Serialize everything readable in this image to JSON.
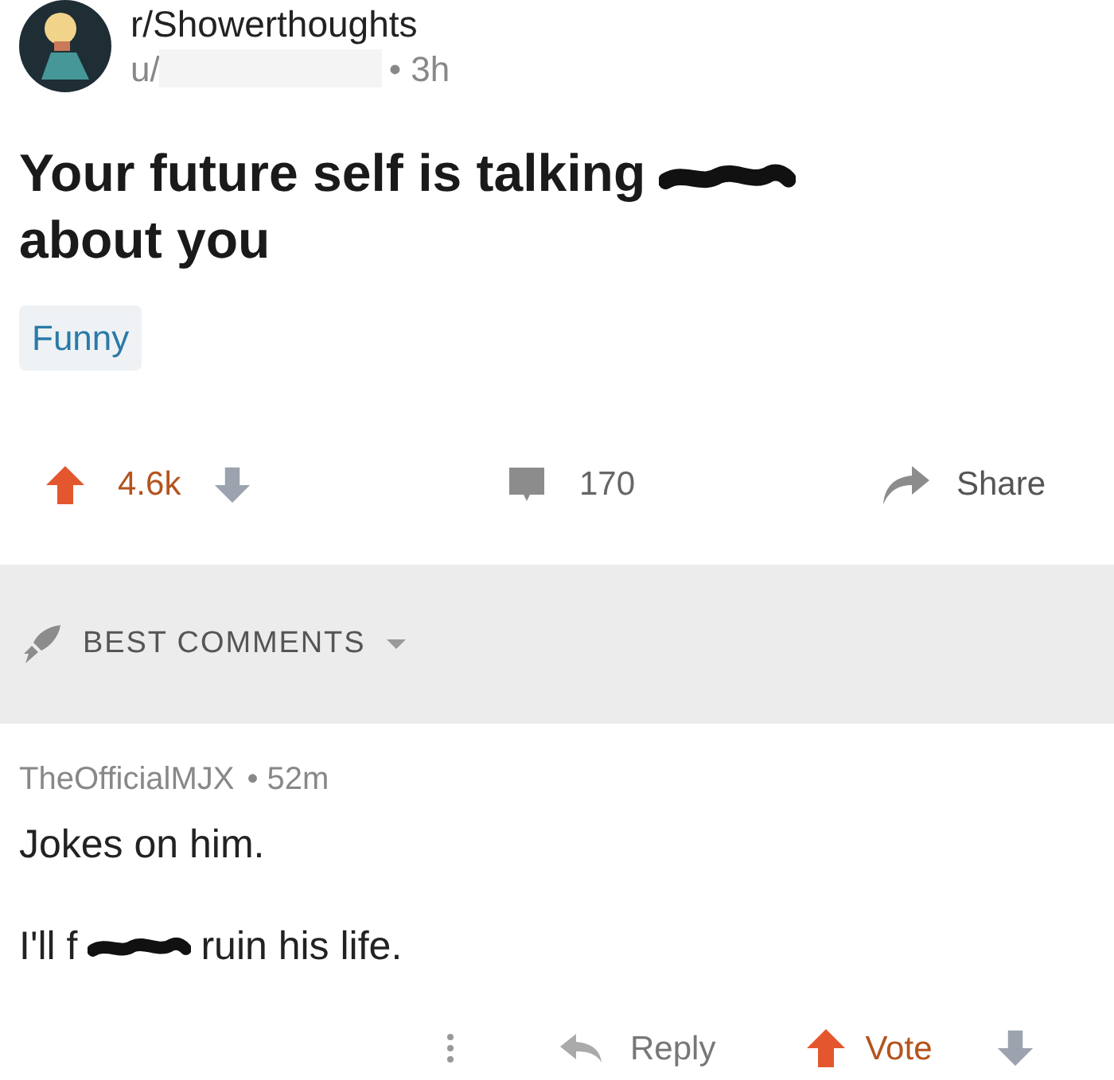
{
  "post": {
    "subreddit": "r/Showerthoughts",
    "author": "u/",
    "author_redacted": true,
    "age": "• 3h",
    "title_parts": [
      {
        "kind": "text",
        "text": "Your future self is talking"
      },
      {
        "kind": "scribble"
      },
      {
        "kind": "text",
        "text": "about you"
      }
    ],
    "flair": "Funny",
    "score": "4.6k",
    "upvoted": true,
    "comments": "170",
    "share": "Share"
  },
  "sort": {
    "label": "BEST COMMENTS"
  },
  "comment": {
    "author": "TheOfficialMJX",
    "age": "• 52m",
    "paragraphs": [
      [
        {
          "kind": "text",
          "text": "Jokes on him."
        }
      ],
      [
        {
          "kind": "text",
          "text": "I'll f"
        },
        {
          "kind": "scribble"
        },
        {
          "kind": "text",
          "text": "ruin his life."
        }
      ]
    ],
    "reply": "Reply",
    "vote": "Vote",
    "upvoted": true
  }
}
